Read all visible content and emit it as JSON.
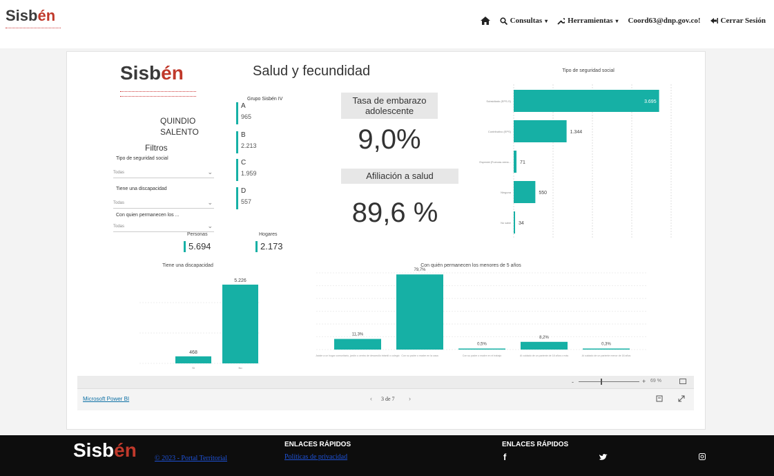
{
  "header": {
    "logo_text_1": "Sisb",
    "logo_text_2": "én",
    "nav": {
      "home_icon": "home-icon",
      "consultas": "Consultas",
      "herramientas": "Herramientas",
      "user": "Coord63@dnp.gov.co!",
      "logout": "Cerrar Sesión"
    }
  },
  "report": {
    "title": "Salud y fecundidad",
    "logo_text_1": "Sisb",
    "logo_text_2": "én",
    "department": "QUINDIO",
    "municipality": "SALENTO",
    "filters_title": "Filtros",
    "filters": [
      {
        "label": "Tipo de seguridad social",
        "value": "Todas"
      },
      {
        "label": "Tiene una discapacidad",
        "value": "Todas"
      },
      {
        "label": "Con quien permanecen los ...",
        "value": "Todas"
      }
    ],
    "group_title": "Grupo Sisbén IV",
    "groups": [
      {
        "label": "A",
        "value": "965"
      },
      {
        "label": "B",
        "value": "2.213"
      },
      {
        "label": "C",
        "value": "1.959"
      },
      {
        "label": "D",
        "value": "557"
      }
    ],
    "teen_pregnancy_title": "Tasa de embarazo adolescente",
    "teen_pregnancy_value": "9,0%",
    "health_affiliation_title": "Afiliación a salud",
    "health_affiliation_value": "89,6 %",
    "kpis": [
      {
        "label": "Personas",
        "value": "5.694"
      },
      {
        "label": "Hogares",
        "value": "2.173"
      }
    ]
  },
  "chart_data": [
    {
      "type": "bar",
      "orientation": "horizontal",
      "title": "Tipo de seguridad social",
      "categories": [
        "Subsidiado (EPS-S)",
        "Contributivo (EPS)",
        "Especial (Fuerzas arma...",
        "Ninguna",
        "No sabe"
      ],
      "values": [
        3695,
        1344,
        71,
        550,
        34
      ],
      "value_labels": [
        "3.695",
        "1.344",
        "71",
        "550",
        "34"
      ],
      "xlim": [
        0,
        4000
      ]
    },
    {
      "type": "bar",
      "title": "Tiene una discapacidad",
      "categories": [
        "Si",
        "No"
      ],
      "values": [
        468,
        5226
      ],
      "value_labels": [
        "468",
        "5.226"
      ],
      "ylim": [
        0,
        5500
      ]
    },
    {
      "type": "bar",
      "title": "Con quién permanecen los menores de 5 años",
      "categories": [
        "Asiste a un hogar comunitario, jardín o centro de desarrollo infantil o colegio",
        "Con su padre o madre en la casa",
        "Con su padre o madre en el trabajo",
        "Al cuidado de un pariente de 18 años o más",
        "Al cuidado de un pariente menor de 18 años"
      ],
      "values": [
        11.3,
        79.7,
        0.5,
        8.2,
        0.3
      ],
      "value_labels": [
        "11,3%",
        "79,7%",
        "0,5%",
        "8,2%",
        "0,3%"
      ],
      "ylim": [
        0,
        85
      ]
    }
  ],
  "powerbi": {
    "zoom": "69 %",
    "brand": "Microsoft Power BI",
    "pager": "3 de 7",
    "prev": "‹",
    "next": "›"
  },
  "footer": {
    "logo_text_1": "Sisb",
    "logo_text_2": "én",
    "copyright": "© 2023 - Portal Territorial",
    "quick_links_1": "ENLACES RÁPIDOS",
    "privacy": "Políticas de privacidad",
    "quick_links_2": "ENLACES RÁPIDOS",
    "facebook": "f",
    "twitter": "twitter-icon",
    "instagram": "instagram-icon"
  },
  "colors": {
    "teal": "#16b0a5",
    "brand_red": "#c0392b",
    "footer_bg": "#0d0d0d"
  }
}
